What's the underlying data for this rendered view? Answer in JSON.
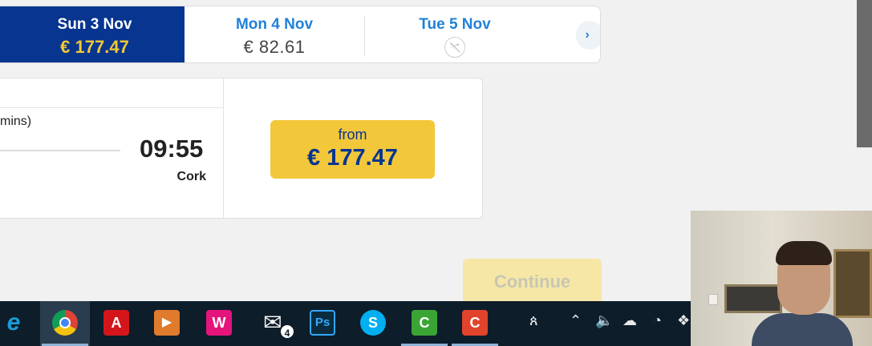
{
  "date_strip": {
    "tabs": [
      {
        "day": "Sun 3 Nov",
        "price": "€ 177.47",
        "selected": true
      },
      {
        "day": "Mon 4 Nov",
        "price": "€ 82.61",
        "selected": false
      },
      {
        "day": "Tue 5 Nov",
        "price": "",
        "status_icon": "no-flights-icon",
        "selected": false
      }
    ],
    "next_icon": "›"
  },
  "flight": {
    "duration_partial": "mins)",
    "arrival_time": "09:55",
    "arrival_city": "Cork",
    "fare_from_label": "from",
    "fare_amount": "€ 177.47"
  },
  "continue_label": "Continue",
  "taskbar": {
    "apps": [
      {
        "name": "internet-explorer-icon",
        "glyph": "e",
        "color": "#1e9bd7"
      },
      {
        "name": "chrome-icon",
        "active": true
      },
      {
        "name": "acrobat-icon",
        "glyph": "A",
        "color": "#d4161c"
      },
      {
        "name": "media-player-icon",
        "glyph": "▶",
        "color": "#e07a2c"
      },
      {
        "name": "wamp-icon",
        "glyph": "W",
        "color": "#e5147b"
      },
      {
        "name": "mail-icon",
        "glyph": "✉",
        "badge": "4"
      },
      {
        "name": "photoshop-icon",
        "glyph": "Ps",
        "color": "#0b2c3e"
      },
      {
        "name": "skype-icon",
        "glyph": "S",
        "color": "#00aff0"
      },
      {
        "name": "camtasia-green-icon",
        "glyph": "C",
        "color": "#3aa535"
      },
      {
        "name": "camtasia-red-icon",
        "glyph": "C",
        "color": "#e2432b"
      }
    ],
    "tray": [
      "people-icon",
      "chevron-up-icon",
      "volume-icon",
      "onedrive-icon",
      "wifi-icon",
      "dropbox-icon"
    ]
  }
}
